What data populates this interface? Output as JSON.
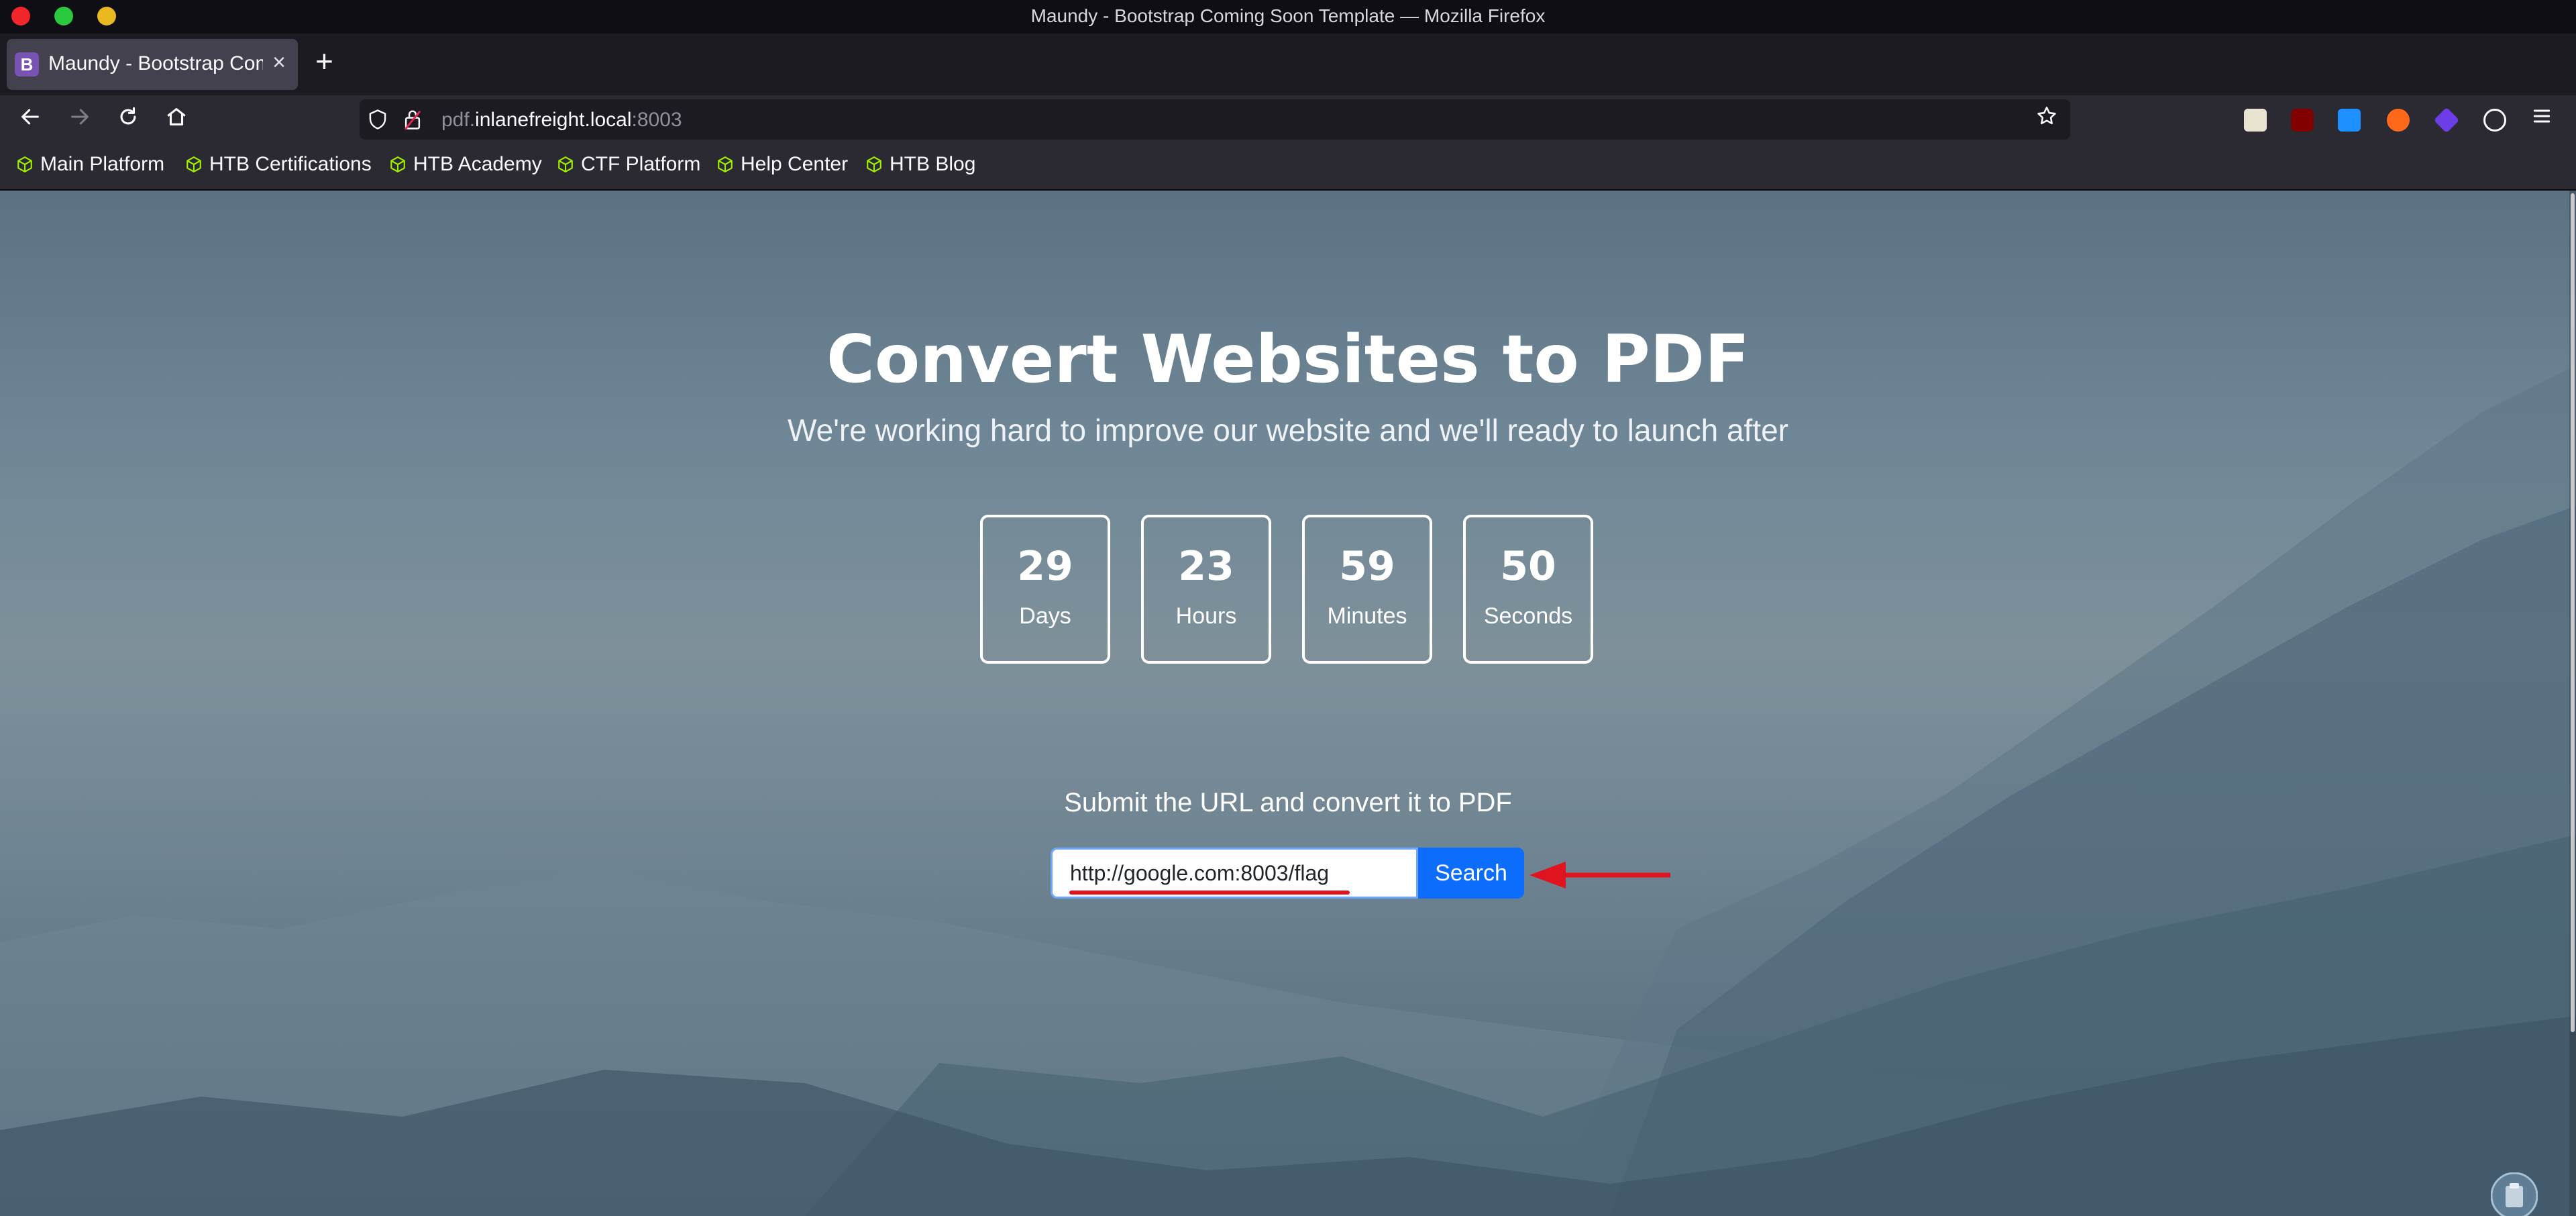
{
  "window": {
    "title": "Maundy - Bootstrap Coming Soon Template — Mozilla Firefox"
  },
  "tab": {
    "favicon_letter": "B",
    "title": "Maundy - Bootstrap Coming Soon Template",
    "close": "×",
    "new_tab": "+"
  },
  "urlbar": {
    "host_prefix": "pdf.",
    "host_main": "inlanefreight.local",
    "port": ":8003"
  },
  "bookmarks": [
    {
      "label": "Main Platform"
    },
    {
      "label": "HTB Certifications"
    },
    {
      "label": "HTB Academy"
    },
    {
      "label": "CTF Platform"
    },
    {
      "label": "Help Center"
    },
    {
      "label": "HTB Blog"
    }
  ],
  "hero": {
    "title": "Convert Websites to PDF",
    "subtitle": "We're working hard to improve our website and we'll ready to launch after"
  },
  "countdown": [
    {
      "value": "29",
      "label": "Days"
    },
    {
      "value": "23",
      "label": "Hours"
    },
    {
      "value": "59",
      "label": "Minutes"
    },
    {
      "value": "50",
      "label": "Seconds"
    }
  ],
  "form": {
    "label": "Submit the URL and convert it to PDF",
    "url_value": "http://google.com:8003/flag",
    "button": "Search"
  },
  "colors": {
    "accent_button": "#0d6efd",
    "annotation_red": "#e0131e"
  },
  "icons": {
    "back": "arrow-left-icon",
    "forward": "arrow-right-icon",
    "reload": "reload-icon",
    "home": "home-icon",
    "bookmark_star": "star-icon",
    "menu": "hamburger-menu-icon"
  }
}
